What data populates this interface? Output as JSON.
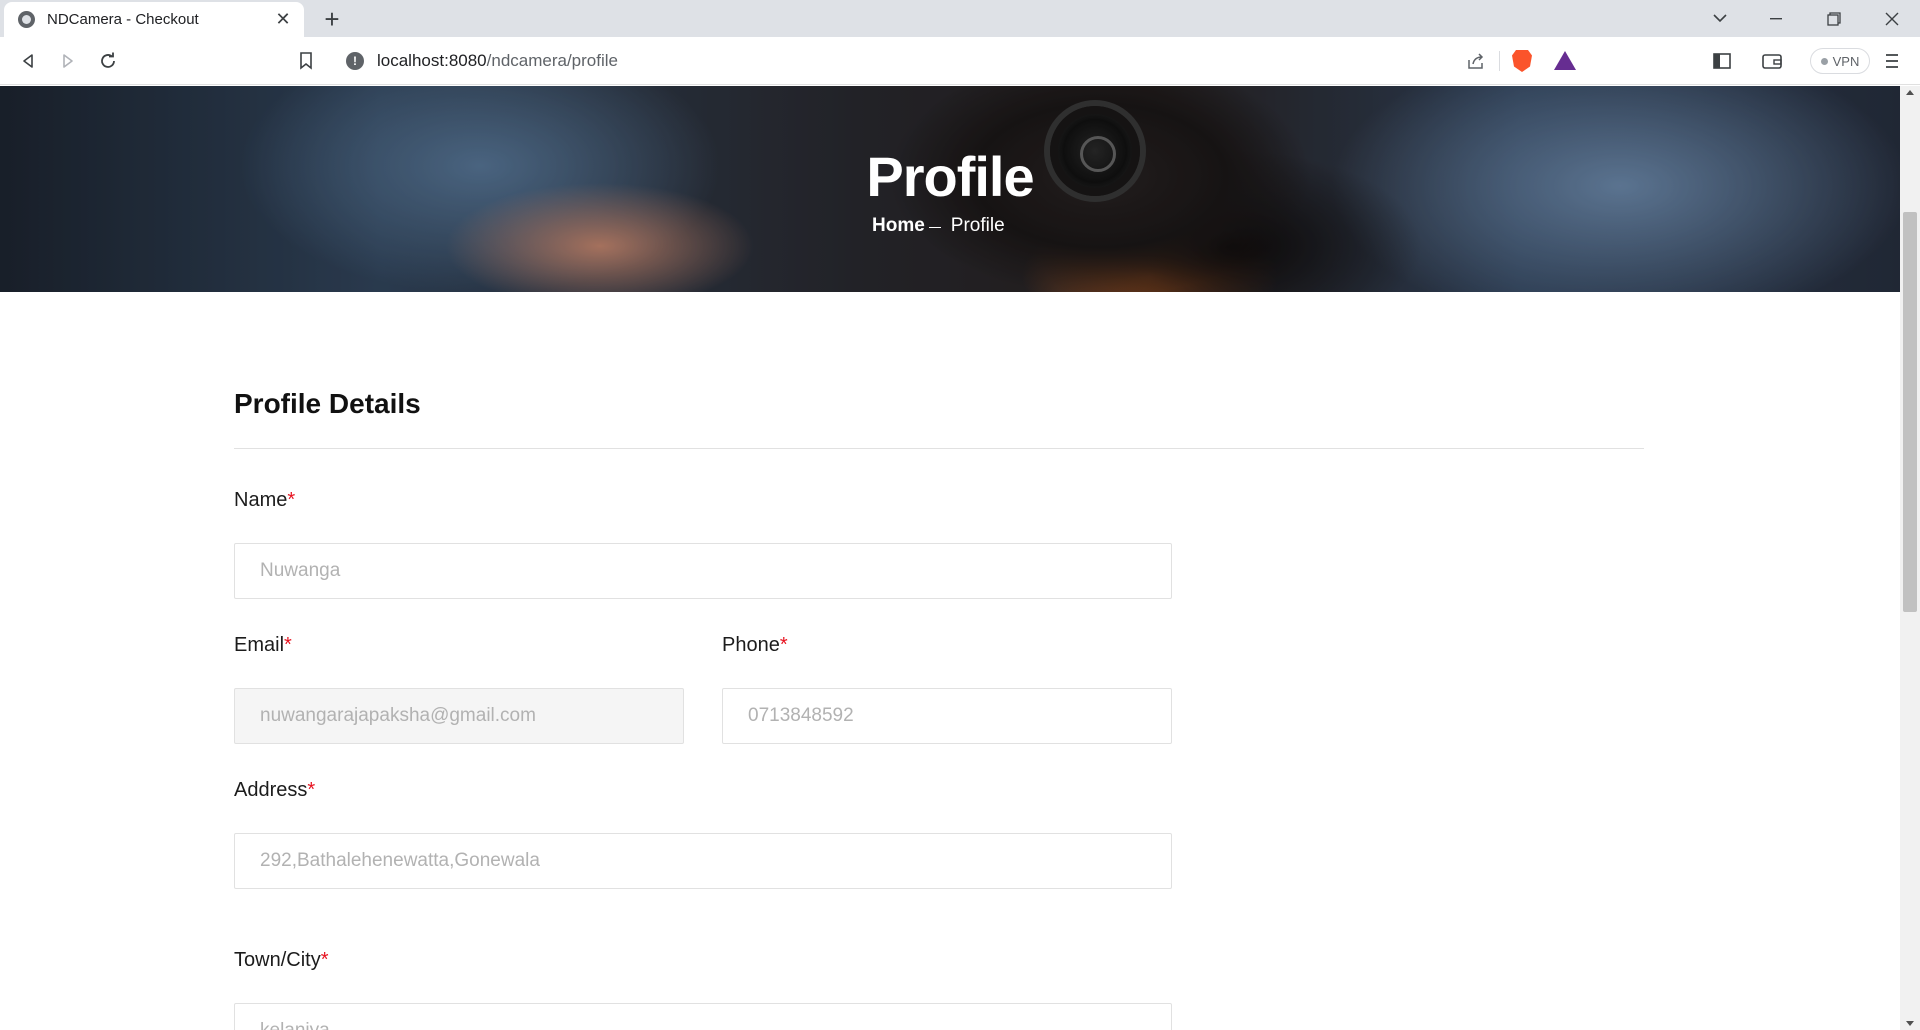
{
  "browser": {
    "tab_title": "NDCamera - Checkout",
    "url_host": "localhost:8080",
    "url_path": "/ndcamera/profile",
    "vpn_label": "VPN"
  },
  "hero": {
    "title": "Profile",
    "breadcrumb_home": "Home",
    "breadcrumb_current": "Profile"
  },
  "profile": {
    "section_title": "Profile Details",
    "required_marker": "*",
    "name_label": "Name",
    "name_value": "Nuwanga",
    "email_label": "Email",
    "email_value": "nuwangarajapaksha@gmail.com",
    "phone_label": "Phone",
    "phone_value": "0713848592",
    "address_label": "Address",
    "address_value": "292,Bathalehenewatta,Gonewala",
    "town_label": "Town/City",
    "town_value": "kelaniya"
  },
  "colors": {
    "required": "#e7121f",
    "input_border": "#e1e1e1",
    "input_text": "#b2b2b2"
  }
}
